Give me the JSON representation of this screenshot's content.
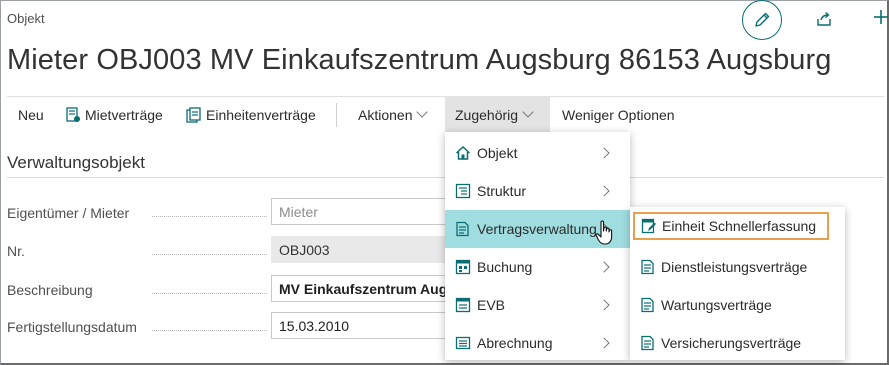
{
  "page": {
    "breadcrumb": "Objekt",
    "title": "Mieter OBJ003 MV Einkaufszentrum Augsburg 86153 Augsburg"
  },
  "actions": {
    "new": "Neu",
    "leases": "Mietverträge",
    "unit_contracts": "Einheitenverträge",
    "actions": "Aktionen",
    "related": "Zugehörig",
    "fewer": "Weniger Optionen"
  },
  "section": {
    "title": "Verwaltungsobjekt"
  },
  "fields": [
    {
      "label": "Eigentümer / Mieter",
      "value": "",
      "placeholder": "Mieter"
    },
    {
      "label": "Nr.",
      "value": "OBJ003"
    },
    {
      "label": "Beschreibung",
      "value": "MV Einkaufszentrum Augsburg"
    },
    {
      "label": "Fertigstellungsdatum",
      "value": "15.03.2010"
    }
  ],
  "menu": {
    "items": [
      {
        "label": "Objekt",
        "icon": "home-icon"
      },
      {
        "label": "Struktur",
        "icon": "structure-icon"
      },
      {
        "label": "Vertragsverwaltung",
        "icon": "contract-icon",
        "highlighted": true
      },
      {
        "label": "Buchung",
        "icon": "booking-icon"
      },
      {
        "label": "EVB",
        "icon": "evb-icon"
      },
      {
        "label": "Abrechnung",
        "icon": "billing-icon"
      }
    ]
  },
  "submenu": {
    "items": [
      {
        "label": "Einheit Schnellerfassung",
        "icon": "edit-document-icon",
        "focused": true
      },
      {
        "label": "Dienstleistungsverträge",
        "icon": "document-icon"
      },
      {
        "label": "Wartungsverträge",
        "icon": "document-icon"
      },
      {
        "label": "Versicherungsverträge",
        "icon": "document-icon"
      }
    ]
  },
  "colors": {
    "accent": "#0a6d72",
    "highlight": "#9fdde0",
    "focus_border": "#e8a04e"
  }
}
